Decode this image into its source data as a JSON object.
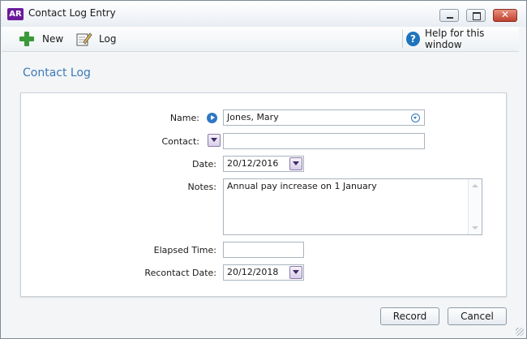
{
  "window": {
    "app_icon_text": "AR",
    "title": "Contact Log Entry"
  },
  "toolbar": {
    "new_label": "New",
    "log_label": "Log",
    "help_label": "Help for this window",
    "help_glyph": "?"
  },
  "section": {
    "title": "Contact Log"
  },
  "form": {
    "name_label": "Name:",
    "name_value": "Jones, Mary",
    "contact_label": "Contact:",
    "contact_value": "",
    "date_label": "Date:",
    "date_value": "20/12/2016",
    "notes_label": "Notes:",
    "notes_value": "Annual pay increase on 1 January",
    "elapsed_label": "Elapsed Time:",
    "elapsed_value": "",
    "recontact_label": "Recontact Date:",
    "recontact_value": "20/12/2018"
  },
  "buttons": {
    "record_label": "Record",
    "cancel_label": "Cancel"
  },
  "colors": {
    "accent": "#3d7ab8",
    "app_icon": "#6a1b9a",
    "new_icon": "#3a9a3a",
    "help_icon": "#1e73be"
  },
  "icons": [
    "app-icon",
    "plus-icon",
    "log-edit-icon",
    "help-icon",
    "arrow-right-icon",
    "chevron-down-icon",
    "minimize-icon",
    "maximize-icon",
    "close-icon"
  ]
}
